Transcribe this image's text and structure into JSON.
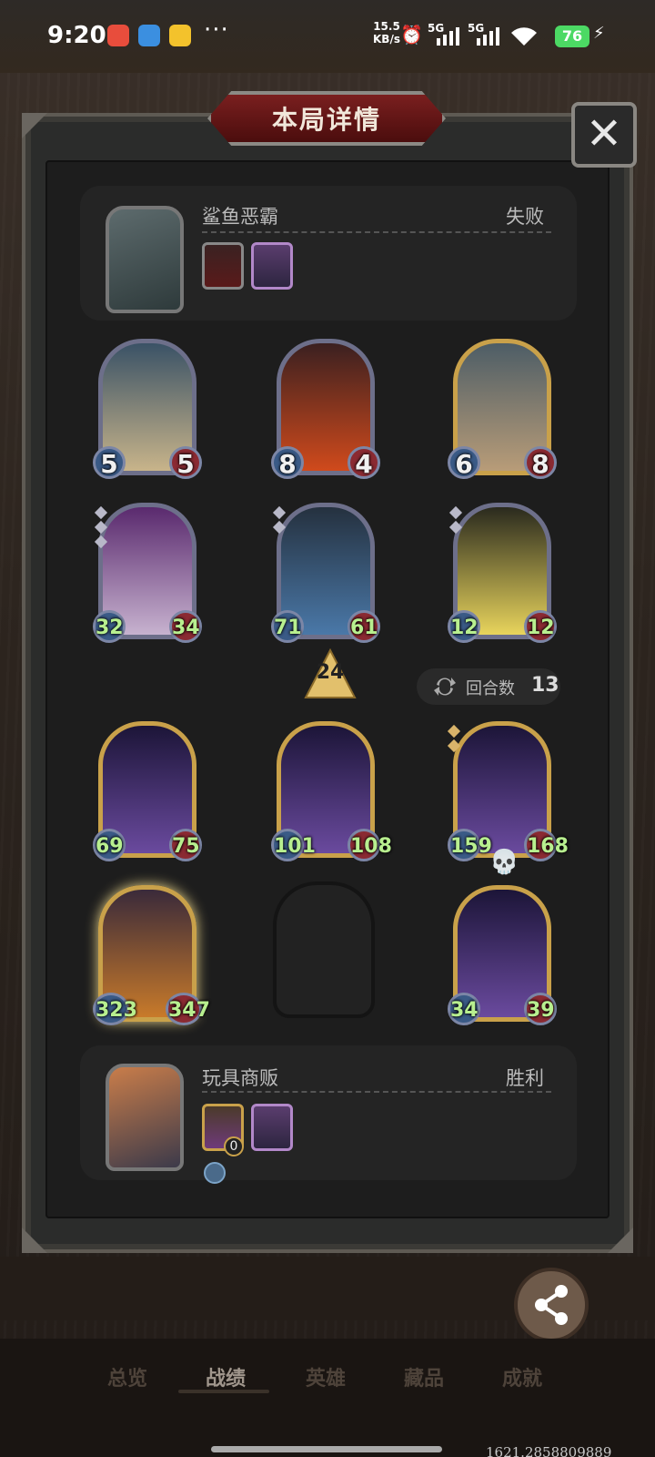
{
  "status_bar": {
    "time": "9:20",
    "dots": "···",
    "net_speed_value": "15.5",
    "net_speed_unit": "KB/s",
    "signal1": "5G",
    "signal2": "5G",
    "battery": "76"
  },
  "dialog": {
    "title": "本局详情",
    "close_label": "✕"
  },
  "opponent": {
    "name": "鲨鱼恶霸",
    "result": "失败"
  },
  "player": {
    "name": "玩具商贩",
    "result": "胜利",
    "mini_badge": "0"
  },
  "opponent_board": [
    {
      "attack": "5",
      "health": "5",
      "frame": "silver",
      "buffed": false
    },
    {
      "attack": "8",
      "health": "4",
      "frame": "silver",
      "buffed": false
    },
    {
      "attack": "6",
      "health": "8",
      "frame": "gold",
      "buffed": false
    },
    {
      "attack": "32",
      "health": "34",
      "frame": "silver",
      "buffed": true
    },
    {
      "attack": "71",
      "health": "61",
      "frame": "silver",
      "buffed": true
    },
    {
      "attack": "12",
      "health": "12",
      "frame": "silver",
      "buffed": true
    }
  ],
  "player_board": [
    {
      "attack": "69",
      "health": "75",
      "frame": "gold",
      "buffed": true
    },
    {
      "attack": "101",
      "health": "108",
      "frame": "gold",
      "buffed": true
    },
    {
      "attack": "159",
      "health": "168",
      "frame": "gold",
      "buffed": true
    },
    {
      "attack": "323",
      "health": "347",
      "frame": "gold",
      "buffed": true
    },
    {
      "attack": "34",
      "health": "39",
      "frame": "gold",
      "buffed": true
    }
  ],
  "tavern_tier": "24",
  "rounds": {
    "label": "回合数",
    "value": "13"
  },
  "share": {
    "label": "分享"
  },
  "bottom_nav": [
    {
      "label": "总览",
      "active": false
    },
    {
      "label": "战绩",
      "active": true
    },
    {
      "label": "英雄",
      "active": false
    },
    {
      "label": "藏品",
      "active": false
    },
    {
      "label": "成就",
      "active": false
    }
  ],
  "coords_text": "1621.2858809889",
  "colors": {
    "title_banner": "#7a1f1f",
    "stat_green": "#b8ef8f",
    "gold_frame": "#c9a14a"
  }
}
